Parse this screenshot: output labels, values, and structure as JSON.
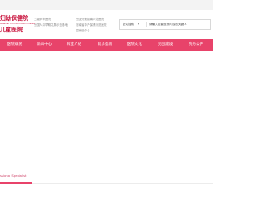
{
  "logo": {
    "line1": "妇幼保健院",
    "subtitle": "Maternal and Child Health Hospital",
    "line2": "儿童医院"
  },
  "header_notes": {
    "col1": [
      "三级甲等医院",
      "全国人口早期发展示范基地"
    ],
    "col2": [
      "全国分娩镇痛示范医院",
      "河南省孕产保健示范医院",
      "国家级中心"
    ]
  },
  "search": {
    "select_label": "全站搜索",
    "placeholder": "请输入您要查找内容的关键字"
  },
  "nav": {
    "items": [
      "医院概况",
      "新闻中心",
      "科室介绍",
      "就诊指南",
      "医院文化",
      "党团建设",
      "院务公开"
    ]
  },
  "section": {
    "title": "ssional Specialist"
  },
  "colors": {
    "brand": "#e8436a",
    "logo": "#c8103a",
    "topbar": "#f3f3f3"
  }
}
